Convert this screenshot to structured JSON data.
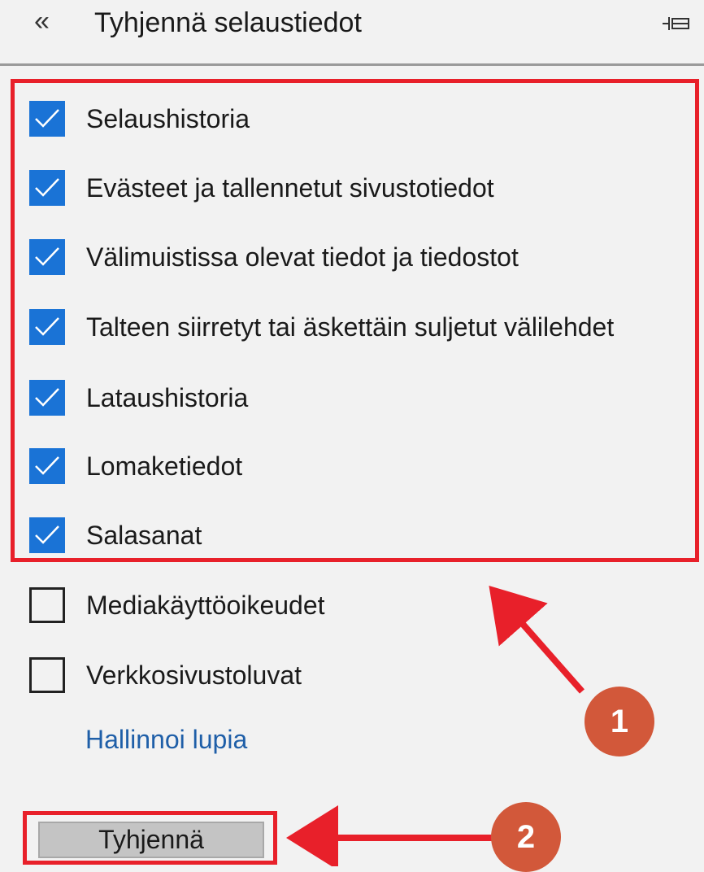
{
  "header": {
    "back_icon": "«",
    "title": "Tyhjennä selaustiedot",
    "pin_icon": "pin-icon"
  },
  "options": [
    {
      "label": "Selaushistoria",
      "checked": true
    },
    {
      "label": "Evästeet ja tallennetut sivustotiedot",
      "checked": true
    },
    {
      "label": "Välimuistissa olevat tiedot ja tiedostot",
      "checked": true
    },
    {
      "label": "Talteen siirretyt tai äskettäin suljetut välilehdet",
      "checked": true
    },
    {
      "label": "Lataushistoria",
      "checked": true
    },
    {
      "label": "Lomaketiedot",
      "checked": true
    },
    {
      "label": "Salasanat",
      "checked": true
    },
    {
      "label": "Mediakäyttöoikeudet",
      "checked": false
    },
    {
      "label": "Verkkosivustoluvat",
      "checked": false
    }
  ],
  "manage_link": "Hallinnoi lupia",
  "clear_button": "Tyhjennä",
  "annotations": {
    "badge1": "1",
    "badge2": "2",
    "highlight_color": "#e8202a",
    "badge_color": "#d2583a"
  },
  "colors": {
    "checkbox_checked": "#1a73d6",
    "link": "#1f5fa8",
    "background": "#f2f2f2"
  }
}
